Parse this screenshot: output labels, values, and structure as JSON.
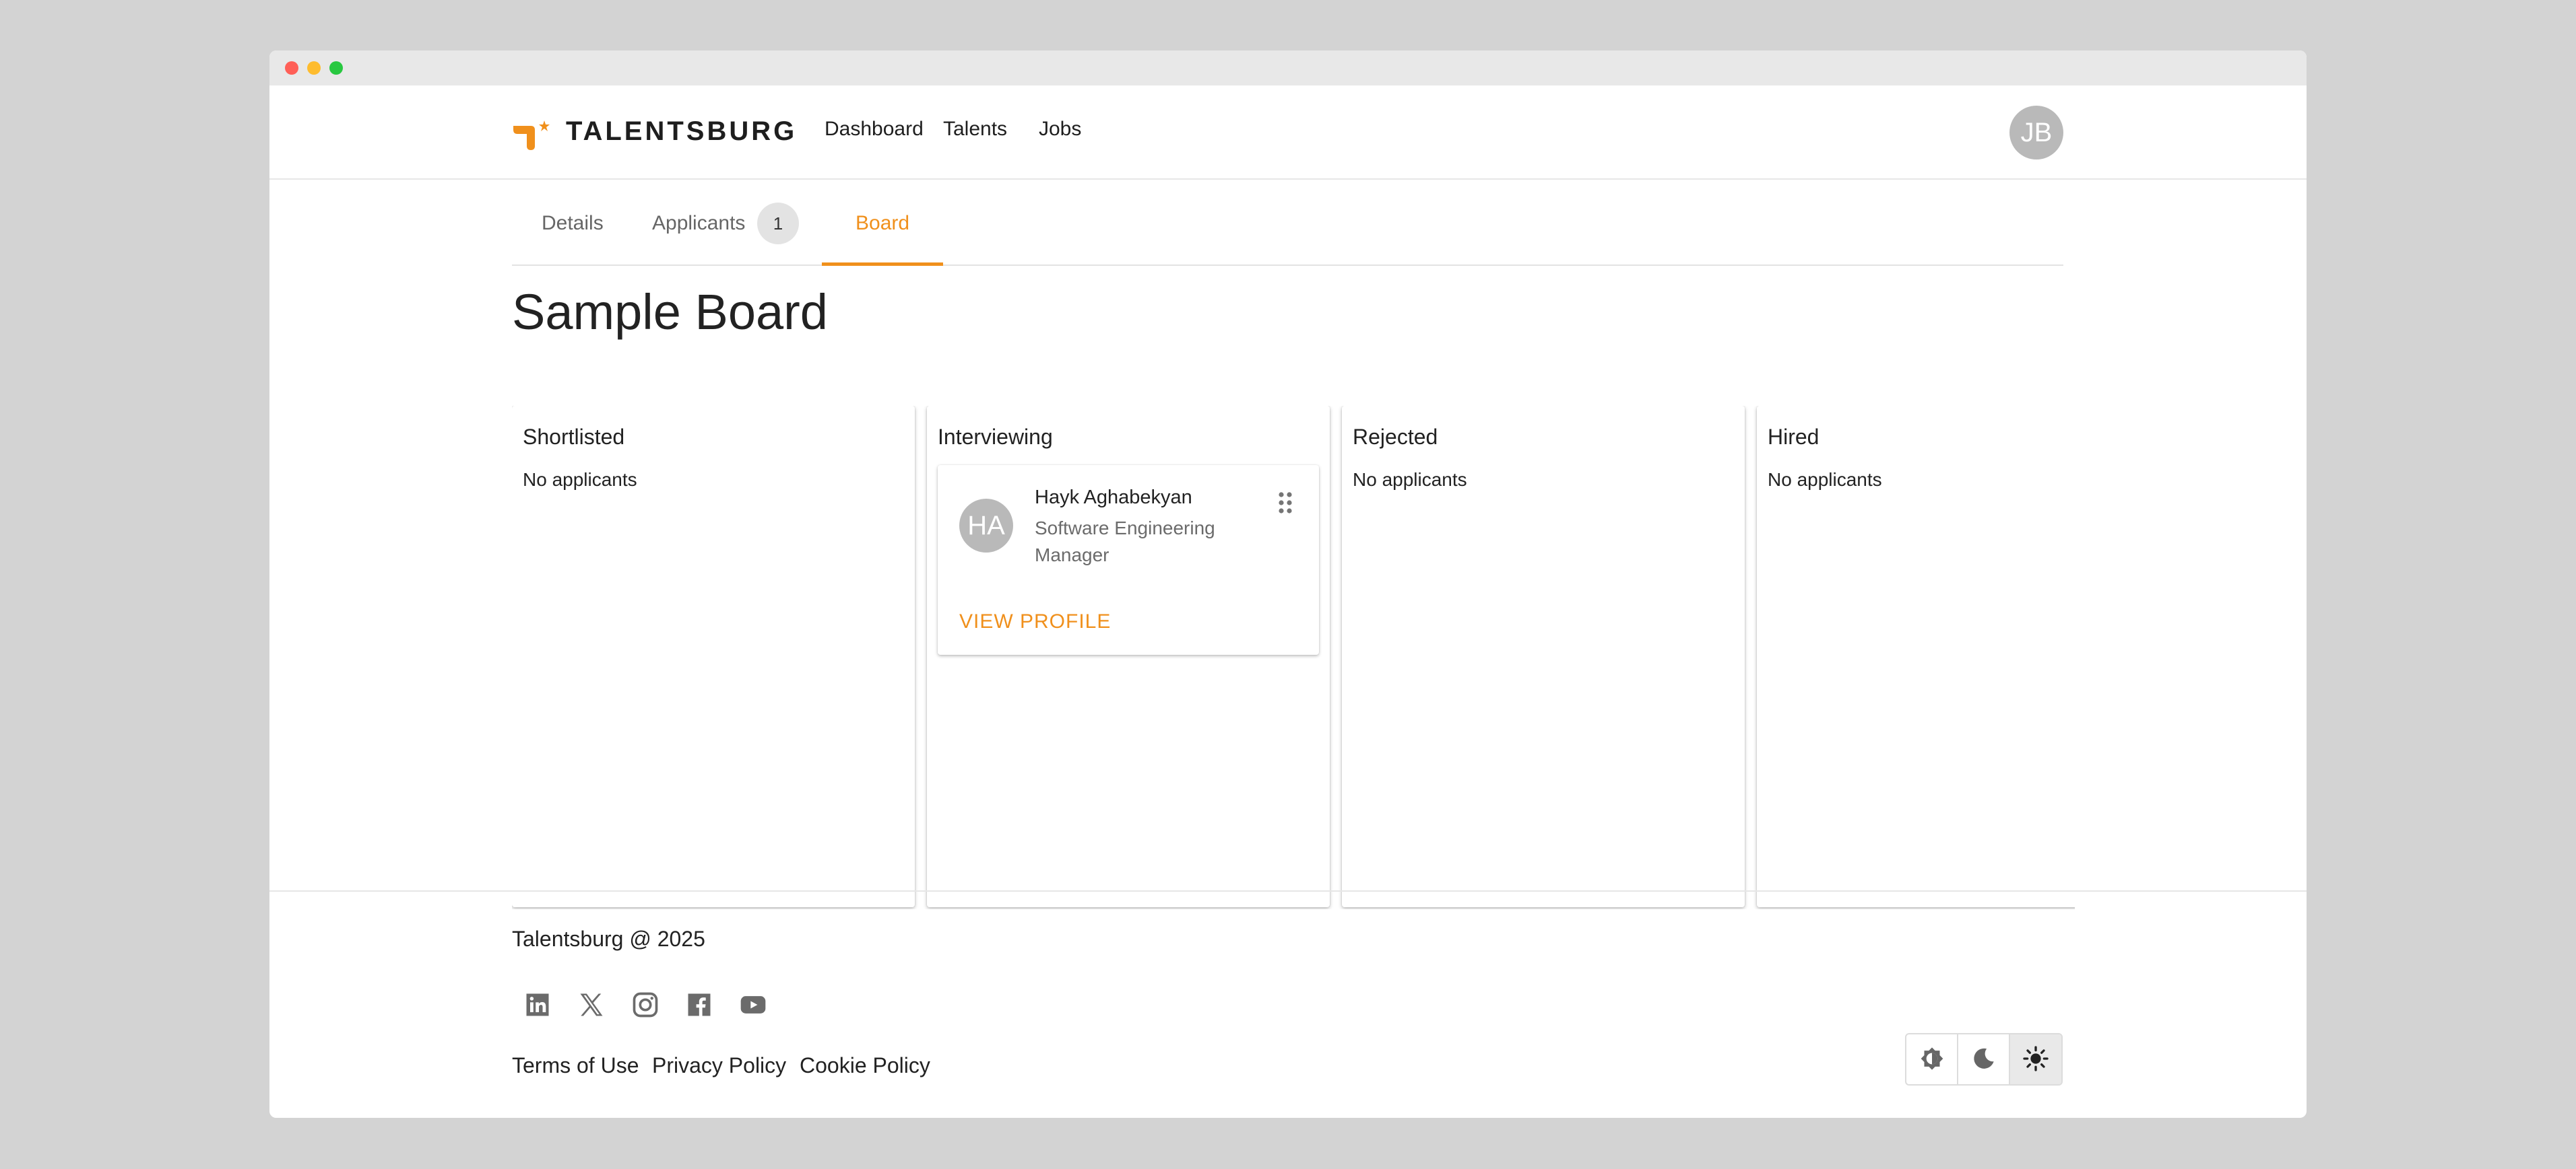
{
  "header": {
    "brand": "TALENTSBURG",
    "nav": [
      "Dashboard",
      "Talents",
      "Jobs"
    ],
    "user_initials": "JB",
    "colors": {
      "accent": "#f0901c"
    }
  },
  "tabs": [
    {
      "label": "Details",
      "active": false
    },
    {
      "label": "Applicants",
      "badge": "1",
      "active": false
    },
    {
      "label": "Board",
      "active": true
    }
  ],
  "board": {
    "title": "Sample Board",
    "columns": [
      {
        "title": "Shortlisted",
        "empty_text": "No applicants"
      },
      {
        "title": "Interviewing",
        "cards": [
          {
            "initials": "HA",
            "name": "Hayk Aghabekyan",
            "role": "Software Engineering Manager",
            "action": "VIEW PROFILE",
            "icon": "drag-handle-icon"
          }
        ]
      },
      {
        "title": "Rejected",
        "empty_text": "No applicants"
      },
      {
        "title": "Hired",
        "empty_text": "No applicants"
      }
    ]
  },
  "footer": {
    "copyright": "Talentsburg @ 2025",
    "social_icons": [
      "linkedin-icon",
      "x-icon",
      "instagram-icon",
      "facebook-icon",
      "youtube-icon"
    ],
    "links": [
      "Terms of Use",
      "Privacy Policy",
      "Cookie Policy"
    ],
    "theme_options": [
      {
        "icon": "auto-brightness-icon",
        "selected": false
      },
      {
        "icon": "moon-icon",
        "selected": false
      },
      {
        "icon": "sun-icon",
        "selected": true
      }
    ]
  }
}
